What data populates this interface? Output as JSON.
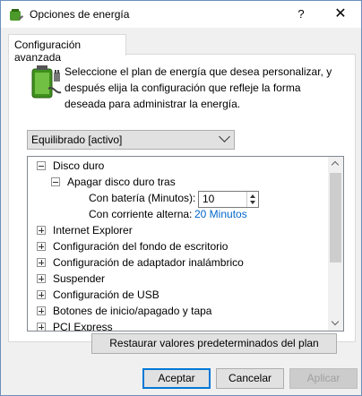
{
  "window": {
    "title": "Opciones de energía",
    "help_glyph": "?",
    "close_glyph": "✕"
  },
  "tab": {
    "label": "Configuración avanzada"
  },
  "intro_text": "Seleccione el plan de energía que desea personalizar, y después elija la configuración que refleje la forma deseada para administrar la energía.",
  "plan_dropdown": {
    "selected": "Equilibrado [activo]"
  },
  "tree": {
    "items": [
      {
        "label": "Disco duro",
        "expanded": true
      },
      {
        "label": "Apagar disco duro tras",
        "expanded": true
      },
      {
        "label": "Con batería (Minutos):",
        "value": "10"
      },
      {
        "label": "Con corriente alterna:",
        "value": "20 Minutos"
      },
      {
        "label": "Internet Explorer"
      },
      {
        "label": "Configuración del fondo de escritorio"
      },
      {
        "label": "Configuración de adaptador inalámbrico"
      },
      {
        "label": "Suspender"
      },
      {
        "label": "Configuración de USB"
      },
      {
        "label": "Botones de inicio/apagado y tapa"
      },
      {
        "label": "PCI Express"
      }
    ]
  },
  "buttons": {
    "restore": "Restaurar valores predeterminados del plan",
    "accept": "Aceptar",
    "cancel": "Cancelar",
    "apply": "Aplicar"
  },
  "icons": {
    "title": "power-options-icon",
    "battery": "battery-plug-icon",
    "spin_up": "spin-up-icon",
    "spin_down": "spin-down-icon"
  },
  "colors": {
    "link": "#0066cc",
    "accent": "#0078d7"
  }
}
